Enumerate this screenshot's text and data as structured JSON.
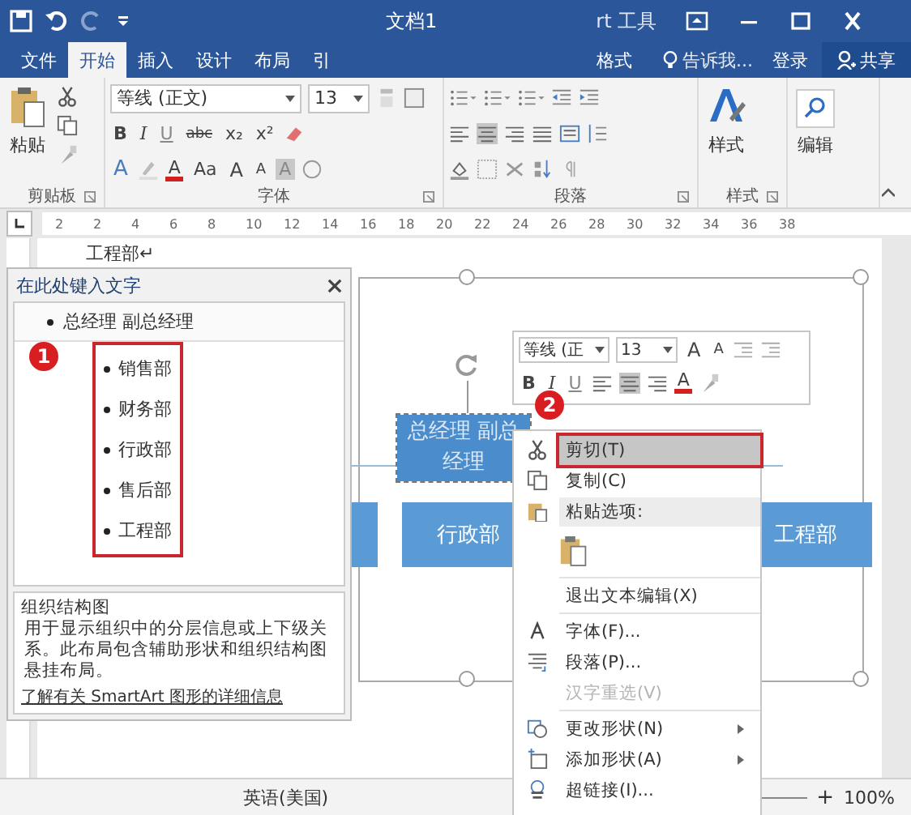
{
  "window": {
    "title": "文档1",
    "context_title": "rt 工具"
  },
  "tabs": [
    {
      "label": "文件",
      "selected": false
    },
    {
      "label": "开始",
      "selected": true
    },
    {
      "label": "插入",
      "selected": false
    },
    {
      "label": "设计",
      "selected": false
    },
    {
      "label": "布局",
      "selected": false
    },
    {
      "label": "引",
      "selected": false
    },
    {
      "label": "格式",
      "selected": false
    }
  ],
  "tell_me": "告诉我...",
  "sign_in": "登录",
  "share": "共享",
  "ribbon": {
    "clipboard": {
      "paste": "粘贴",
      "label": "剪贴板"
    },
    "font": {
      "name": "等线 (正文)",
      "size": "13",
      "formats": [
        "B",
        "I",
        "U",
        "abc",
        "x₂",
        "x²"
      ],
      "effects": "A",
      "color_button": "A",
      "case": "Aa",
      "grow": "A",
      "shrink": "A",
      "shade": "A",
      "label": "字体"
    },
    "paragraph": {
      "alignment": [
        {
          "selected": false
        },
        {
          "selected": true
        },
        {
          "selected": false
        },
        {
          "selected": false
        }
      ],
      "label": "段落"
    },
    "styles": {
      "button": "样式",
      "label": "样式"
    },
    "editing": {
      "button": "编辑"
    }
  },
  "ruler": [
    "2",
    "2",
    "4",
    "6",
    "8",
    "10",
    "12",
    "14",
    "16",
    "18",
    "20",
    "22",
    "24",
    "26",
    "28",
    "30",
    "32",
    "34",
    "36",
    "38"
  ],
  "document_text": "工程部↵",
  "text_pane": {
    "title": "在此处键入文字",
    "items": [
      {
        "text": "总经理 副总经理",
        "children": [
          {
            "text": "销售部"
          },
          {
            "text": "财务部"
          },
          {
            "text": "行政部"
          },
          {
            "text": "售后部"
          },
          {
            "text": "工程部"
          }
        ]
      }
    ],
    "description_title": "组织结构图",
    "description": "用于显示组织中的分层信息或上下级关系。此布局包含辅助形状和组织结构图悬挂布局。",
    "link": "了解有关 SmartArt 图形的详细信息"
  },
  "smartart": {
    "top_box": {
      "text": "总经理 副总经理",
      "selected": true
    },
    "boxes": [
      "行政部",
      "工程部"
    ]
  },
  "mini_toolbar": {
    "font": "等线 (正",
    "size": "13",
    "grow": "A",
    "shrink": "A",
    "formats": [
      "B",
      "I",
      "U"
    ],
    "alignment": [
      {
        "selected": false
      },
      {
        "selected": true
      },
      {
        "selected": false
      }
    ],
    "color_button": "A"
  },
  "context_menu": [
    {
      "kind": "cut",
      "label": "剪切(T)",
      "selected": true,
      "disabled": false,
      "submenu": false
    },
    {
      "kind": "copy",
      "label": "复制(C)",
      "selected": false,
      "disabled": false,
      "submenu": false
    },
    {
      "kind": "paste-header",
      "label": "粘贴选项:",
      "selected": false,
      "disabled": false,
      "submenu": false
    },
    {
      "kind": "paste-option"
    },
    {
      "kind": "exit",
      "label": "退出文本编辑(X)",
      "selected": false,
      "disabled": false,
      "submenu": false
    },
    {
      "kind": "font",
      "label": "字体(F)...",
      "selected": false,
      "disabled": false,
      "submenu": false
    },
    {
      "kind": "paragraph",
      "label": "段落(P)...",
      "selected": false,
      "disabled": false,
      "submenu": false
    },
    {
      "kind": "reselect",
      "label": "汉字重选(V)",
      "selected": false,
      "disabled": true,
      "submenu": false
    },
    {
      "kind": "change-shape",
      "label": "更改形状(N)",
      "selected": false,
      "disabled": false,
      "submenu": true
    },
    {
      "kind": "add-shape",
      "label": "添加形状(A)",
      "selected": false,
      "disabled": false,
      "submenu": true
    },
    {
      "kind": "link",
      "label": "超链接(I)...",
      "selected": false,
      "disabled": false,
      "submenu": false
    }
  ],
  "steps": [
    "1",
    "2"
  ],
  "status_bar": {
    "language": "英语(美国)",
    "zoom_in": "+",
    "zoom": "100%"
  }
}
